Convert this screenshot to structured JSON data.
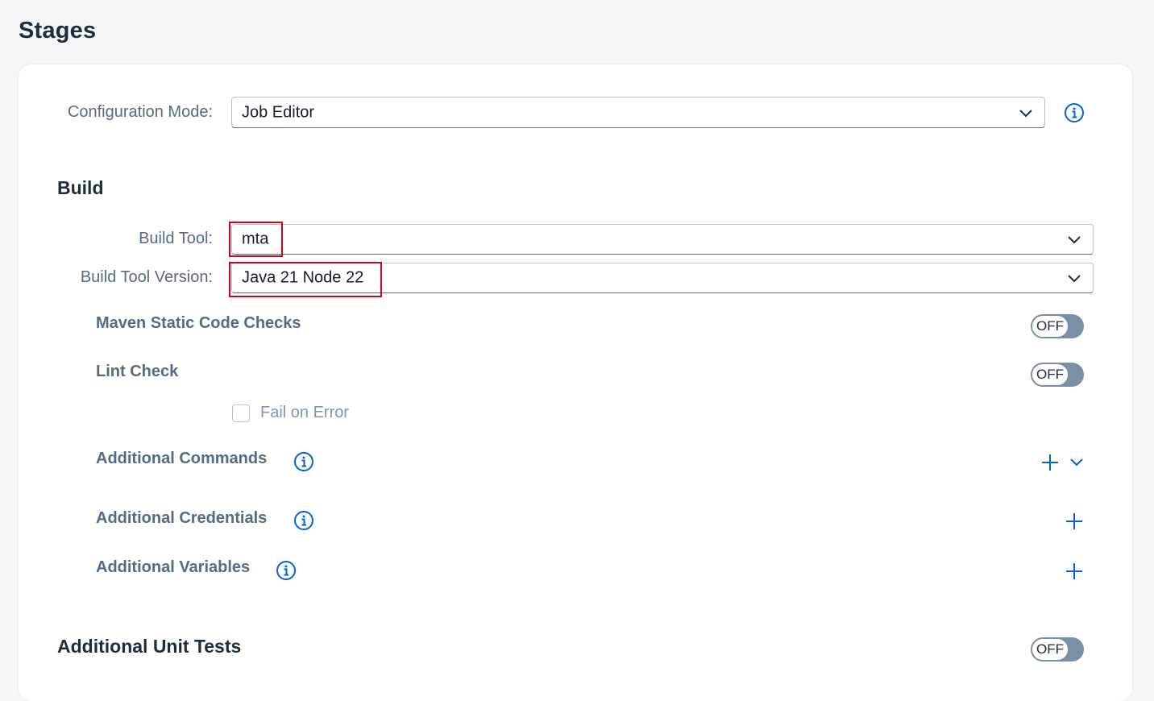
{
  "page": {
    "title": "Stages"
  },
  "config": {
    "mode_label": "Configuration Mode:",
    "mode_value": "Job Editor"
  },
  "build": {
    "title": "Build",
    "tool_label": "Build Tool:",
    "tool_value": "mta",
    "version_label": "Build Tool Version:",
    "version_value": "Java 21 Node 22",
    "maven_label": "Maven Static Code Checks",
    "maven_state": "OFF",
    "lint_label": "Lint Check",
    "lint_state": "OFF",
    "fail_on_error_label": "Fail on Error",
    "commands_label": "Additional Commands",
    "credentials_label": "Additional Credentials",
    "variables_label": "Additional Variables"
  },
  "unit_tests": {
    "title": "Additional Unit Tests",
    "state": "OFF"
  },
  "colors": {
    "accent": "#0064d9",
    "highlight": "#d0021b",
    "toggle_off": "#788fa6"
  }
}
